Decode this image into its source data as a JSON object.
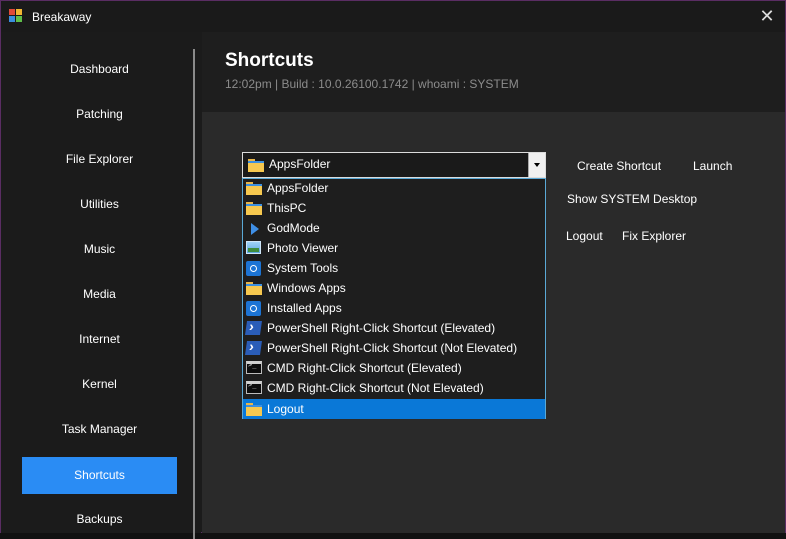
{
  "window": {
    "title": "Breakaway"
  },
  "sidebar": {
    "items": [
      {
        "label": "Dashboard"
      },
      {
        "label": "Patching"
      },
      {
        "label": "File Explorer"
      },
      {
        "label": "Utilities"
      },
      {
        "label": "Music"
      },
      {
        "label": "Media"
      },
      {
        "label": "Internet"
      },
      {
        "label": "Kernel"
      },
      {
        "label": "Task Manager"
      },
      {
        "label": "Shortcuts",
        "active": true
      },
      {
        "label": "Backups"
      }
    ]
  },
  "header": {
    "title": "Shortcuts",
    "subtitle": "12:02pm | Build : 10.0.26100.1742 | whoami : SYSTEM"
  },
  "combo": {
    "selected": "AppsFolder",
    "options": [
      {
        "label": "AppsFolder",
        "icon": "folder-icon"
      },
      {
        "label": "ThisPC",
        "icon": "folder-icon"
      },
      {
        "label": "GodMode",
        "icon": "play-icon"
      },
      {
        "label": "Photo Viewer",
        "icon": "photo-icon"
      },
      {
        "label": "System Tools",
        "icon": "settings-icon"
      },
      {
        "label": "Windows Apps",
        "icon": "folder-icon"
      },
      {
        "label": "Installed Apps",
        "icon": "settings-icon"
      },
      {
        "label": "PowerShell Right-Click Shortcut (Elevated)",
        "icon": "powershell-icon"
      },
      {
        "label": "PowerShell Right-Click Shortcut (Not Elevated)",
        "icon": "powershell-icon"
      },
      {
        "label": "CMD Right-Click Shortcut (Elevated)",
        "icon": "cmd-icon"
      },
      {
        "label": "CMD Right-Click Shortcut (Not Elevated)",
        "icon": "cmd-icon"
      },
      {
        "label": "Logout",
        "icon": "folder-icon",
        "highlighted": true
      }
    ]
  },
  "buttons": {
    "create_shortcut": "Create Shortcut",
    "launch": "Launch",
    "show_system_desktop": "Show SYSTEM Desktop",
    "logout": "Logout",
    "fix_explorer": "Fix Explorer"
  },
  "colors": {
    "accent": "#2a8cf4",
    "dropdown_highlight": "#0a78d7",
    "window_border": "#5a2d63"
  }
}
